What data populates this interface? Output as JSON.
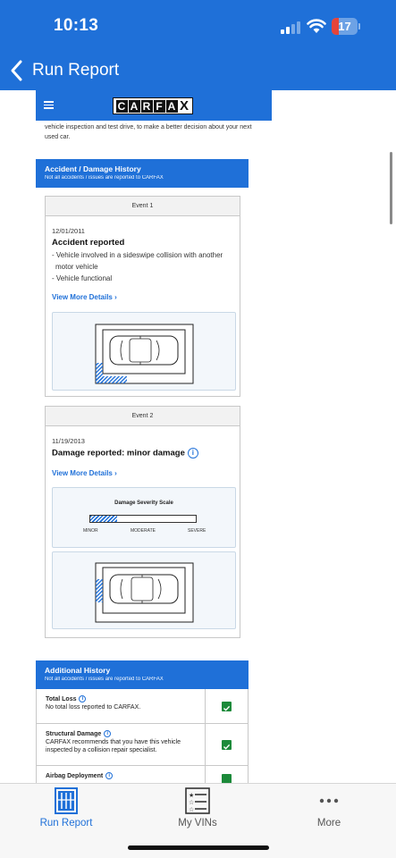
{
  "status": {
    "time": "10:13",
    "battery": "17"
  },
  "nav": {
    "back_label": "Run Report"
  },
  "carfax": {
    "logo_letters": [
      "C",
      "A",
      "R",
      "F",
      "A",
      "X"
    ]
  },
  "intro_text": "vehicle inspection and test drive, to make a better decision about your next used car.",
  "accident_section": {
    "title": "Accident / Damage History",
    "subtitle": "Not all accidents / issues are reported to CARFAX"
  },
  "events": [
    {
      "header": "Event 1",
      "date": "12/01/2011",
      "title": "Accident reported",
      "details": [
        "- Vehicle involved in a sideswipe collision with another motor vehicle",
        "- Vehicle functional"
      ],
      "link": "View More Details ›"
    },
    {
      "header": "Event 2",
      "date": "11/19/2013",
      "title": "Damage reported: minor damage",
      "link": "View More Details ›",
      "severity": {
        "title": "Damage Severity Scale",
        "level_fraction": 0.25,
        "labels": [
          "MINOR",
          "MODERATE",
          "SEVERE"
        ]
      }
    }
  ],
  "additional_section": {
    "title": "Additional History",
    "subtitle": "Not all accidents / issues are reported to CARFAX",
    "rows": [
      {
        "title": "Total Loss",
        "text": "No total loss reported to CARFAX.",
        "checked": true
      },
      {
        "title": "Structural Damage",
        "text": "CARFAX recommends that you have this vehicle inspected by a collision repair specialist.",
        "checked": true
      },
      {
        "title": "Airbag Deployment",
        "text": "",
        "checked": true
      }
    ]
  },
  "tabs": [
    {
      "label": "Run Report",
      "icon": "run-report-icon",
      "active": true
    },
    {
      "label": "My VINs",
      "icon": "list-icon",
      "active": false
    },
    {
      "label": "More",
      "icon": "more-icon",
      "active": false
    }
  ],
  "colors": {
    "brand_blue": "#1f70d8",
    "check_green": "#1c8a3a",
    "battery_red": "#e5443a"
  }
}
